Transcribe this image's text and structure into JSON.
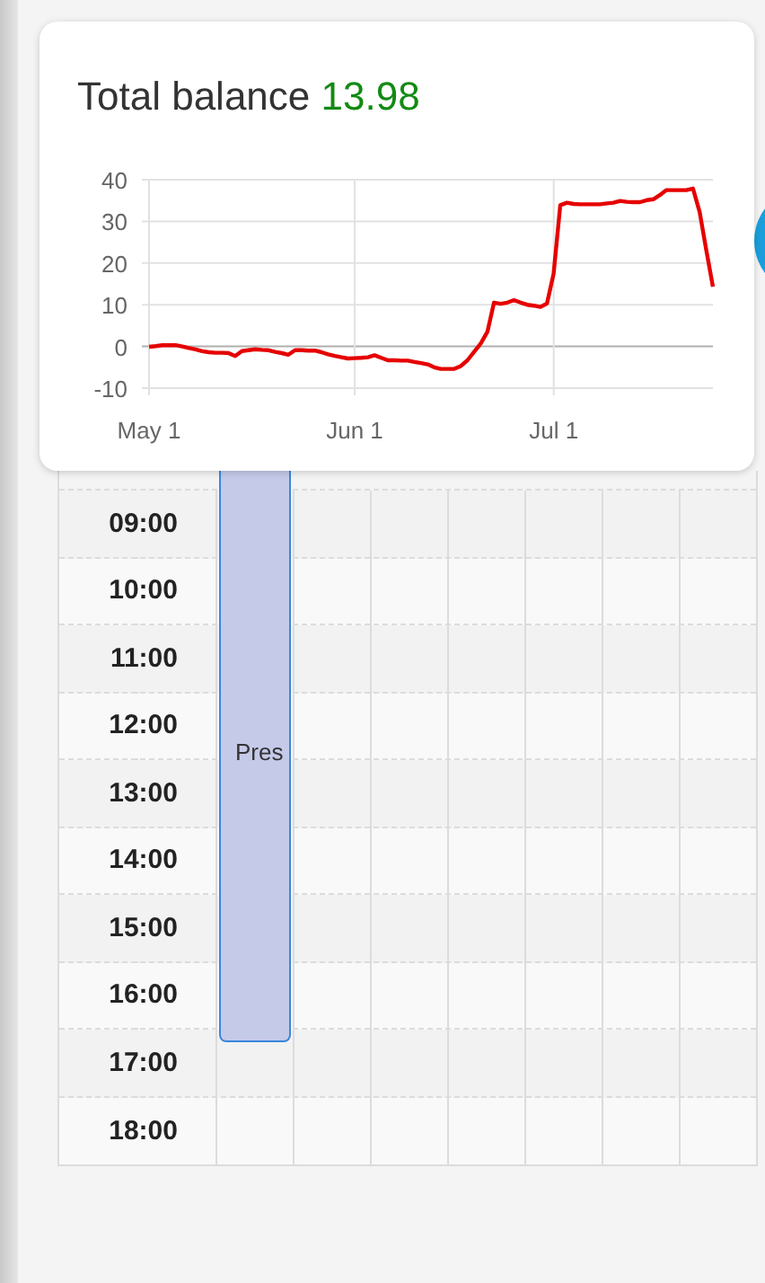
{
  "balance_card": {
    "title": "Total balance",
    "amount": "13.98",
    "chart_data": {
      "type": "line",
      "categories": [
        "May 1",
        null,
        null,
        null,
        null,
        null,
        null,
        null,
        null,
        null,
        null,
        null,
        null,
        null,
        null,
        null,
        null,
        null,
        null,
        null,
        null,
        null,
        null,
        null,
        null,
        null,
        null,
        null,
        null,
        null,
        null,
        "Jun 1",
        null,
        null,
        null,
        null,
        null,
        null,
        null,
        null,
        null,
        null,
        null,
        null,
        null,
        null,
        null,
        null,
        null,
        null,
        null,
        null,
        null,
        null,
        null,
        null,
        null,
        null,
        null,
        null,
        null,
        "Jul 1",
        null,
        null,
        null,
        null,
        null,
        null,
        null,
        null,
        null,
        null,
        null,
        null,
        null,
        null,
        null,
        null,
        null,
        null,
        null,
        null,
        null,
        null,
        null,
        null
      ],
      "series": [
        {
          "color": "#e60000",
          "values": [
            -0.1,
            0.1,
            0.3,
            0.3,
            0.3,
            0,
            -0.4,
            -0.7,
            -1.1,
            -1.4,
            -1.5,
            -1.5,
            -1.6,
            -2.3,
            -1.1,
            -0.9,
            -0.7,
            -0.8,
            -0.9,
            -1.3,
            -1.6,
            -2,
            -0.9,
            -0.9,
            -1,
            -1,
            -1.4,
            -1.9,
            -2.3,
            -2.6,
            -2.9,
            -2.8,
            -2.7,
            -2.6,
            -2.1,
            -2.7,
            -3.3,
            -3.3,
            -3.4,
            -3.4,
            -3.7,
            -4,
            -4.3,
            -5,
            -5.4,
            -5.4,
            -5.4,
            -4.7,
            -3.3,
            -1.3,
            0.7,
            3.5,
            10.5,
            10.2,
            10.5,
            11.1,
            10.5,
            10,
            9.8,
            9.5,
            10.3,
            17.5,
            33.9,
            34.5,
            34.2,
            34.1,
            34.1,
            34.1,
            34.1,
            34.3,
            34.5,
            34.9,
            34.7,
            34.6,
            34.6,
            35.1,
            35.3,
            36.3,
            37.5,
            37.5,
            37.5,
            37.5,
            37.9,
            32.3,
            23.1,
            14.3
          ]
        }
      ],
      "grid": true,
      "ylim": [
        -10,
        40
      ],
      "yticks": [
        -10,
        0,
        10,
        20,
        30,
        40
      ]
    }
  },
  "calendar": {
    "hours": [
      "09:00",
      "10:00",
      "11:00",
      "12:00",
      "13:00",
      "14:00",
      "15:00",
      "16:00",
      "17:00",
      "18:00"
    ],
    "events": [
      {
        "title": "Pres"
      }
    ]
  }
}
